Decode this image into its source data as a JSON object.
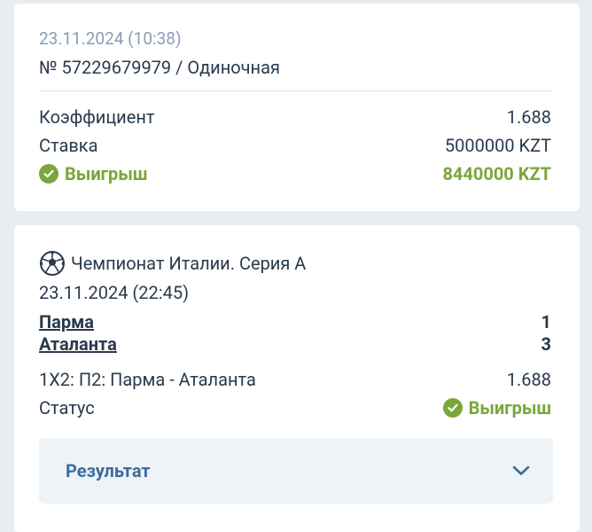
{
  "summary": {
    "date": "23.11.2024 (10:38)",
    "ticket": "№ 57229679979 / Одиночная",
    "coef_label": "Коэффициент",
    "coef_value": "1.688",
    "stake_label": "Ставка",
    "stake_value": "5000000 KZT",
    "win_label": "Выигрыш",
    "win_value": "8440000 KZT"
  },
  "event": {
    "league": "Чемпионат Италии. Серия А",
    "date": "23.11.2024 (22:45)",
    "team1": "Парма",
    "score1": "1",
    "team2": "Аталанта",
    "score2": "3",
    "market": "1X2: П2: Парма - Аталанта",
    "market_coef": "1.688",
    "status_label": "Статус",
    "status_value": "Выигрыш",
    "result_label": "Результат"
  },
  "icons": {
    "sport": "soccer-ball-icon",
    "check": "check-circle-icon",
    "expand": "chevron-down-icon"
  },
  "colors": {
    "win_green": "#7aa63a",
    "muted_text": "#8a9db3",
    "accent_blue": "#3a6d9a",
    "background": "#e8edf2"
  }
}
